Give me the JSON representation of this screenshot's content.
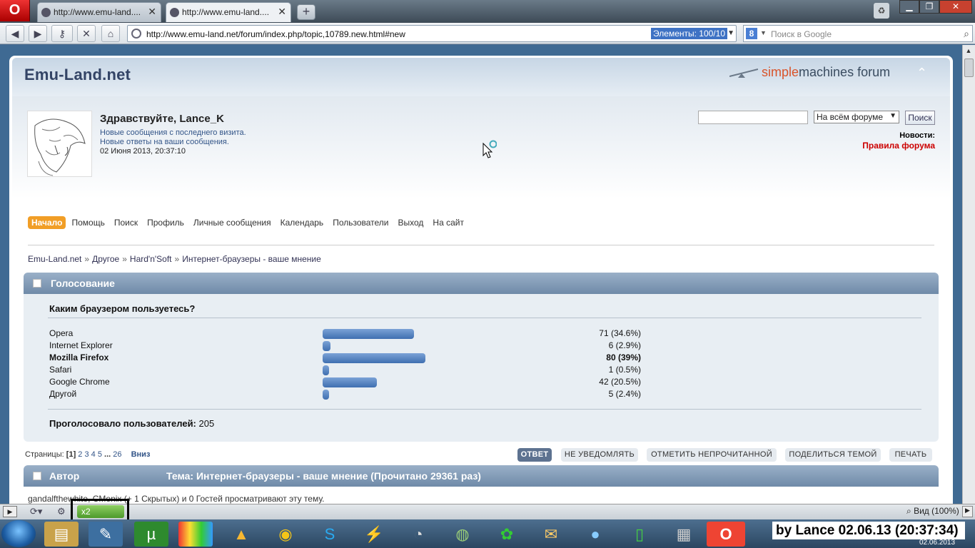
{
  "browser": {
    "tabs": [
      {
        "title": "http://www.emu-land...."
      },
      {
        "title": "http://www.emu-land...."
      }
    ],
    "address": "http://www.emu-land.net/forum/index.php/topic,10789.new.html#new",
    "element_count": "Элементы:  100/10",
    "search_placeholder": "Поиск в Google",
    "google_badge": "8"
  },
  "site": {
    "title": "Emu-Land.net",
    "smf_logo_a": "simple",
    "smf_logo_b": "machines forum"
  },
  "user": {
    "greeting": "Здравствуйте, Lance_K",
    "new_posts": "Новые сообщения с последнего визита.",
    "new_replies": "Новые ответы на ваши сообщения.",
    "date": "02 Июня 2013, 20:37:10"
  },
  "search": {
    "scope": "На всём форуме",
    "button": "Поиск"
  },
  "news": {
    "label": "Новости:",
    "link": "Правила форума"
  },
  "nav": [
    "Начало",
    "Помощь",
    "Поиск",
    "Профиль",
    "Личные сообщения",
    "Календарь",
    "Пользователи",
    "Выход",
    "На сайт"
  ],
  "breadcrumb": [
    "Emu-Land.net",
    "Другое",
    "Hard'n'Soft",
    "Интернет-браузеры - ваше мнение"
  ],
  "poll": {
    "header": "Голосование",
    "question": "Каким браузером пользуетесь?",
    "total_label": "Проголосовало пользователей:",
    "total_value": "205"
  },
  "chart_data": {
    "type": "bar",
    "categories": [
      "Opera",
      "Internet Explorer",
      "Mozilla Firefox",
      "Safari",
      "Google Chrome",
      "Другой"
    ],
    "values": [
      71,
      6,
      80,
      1,
      42,
      5
    ],
    "labels": [
      "71 (34.6%)",
      "6 (2.9%)",
      "80 (39%)",
      "1 (0.5%)",
      "42 (20.5%)",
      "5 (2.4%)"
    ],
    "bold_index": 2,
    "color": "#4f7fc0"
  },
  "pagination": {
    "label": "Страницы:",
    "current": "1",
    "pages": [
      "2",
      "3",
      "4",
      "5"
    ],
    "ellipsis": "...",
    "last": "26",
    "down": "Вниз"
  },
  "buttons": [
    "ОТВЕТ",
    "НЕ УВЕДОМЛЯТЬ",
    "ОТМЕТИТЬ НЕПРОЧИТАННОЙ",
    "ПОДЕЛИТЬСЯ ТЕМОЙ",
    "ПЕЧАТЬ"
  ],
  "topic_bar": {
    "author": "Автор",
    "topic": "Тема: Интернет-браузеры - ваше мнение  (Прочитано 29361 раз)"
  },
  "viewers": "gandalfthewhite, CMonix (+ 1 Скрытых) и 0 Гостей просматривают эту тему.",
  "statusbar": {
    "badge": "x2",
    "zoom": "Вид (100%)"
  },
  "taskbar": {
    "signature": "by Lance 02.06.13 (20:37:34)",
    "date": "02.06.2013"
  },
  "colors": {
    "accent": "#f19e26",
    "header": "#6f8aa8",
    "news_link": "#cc0000"
  }
}
